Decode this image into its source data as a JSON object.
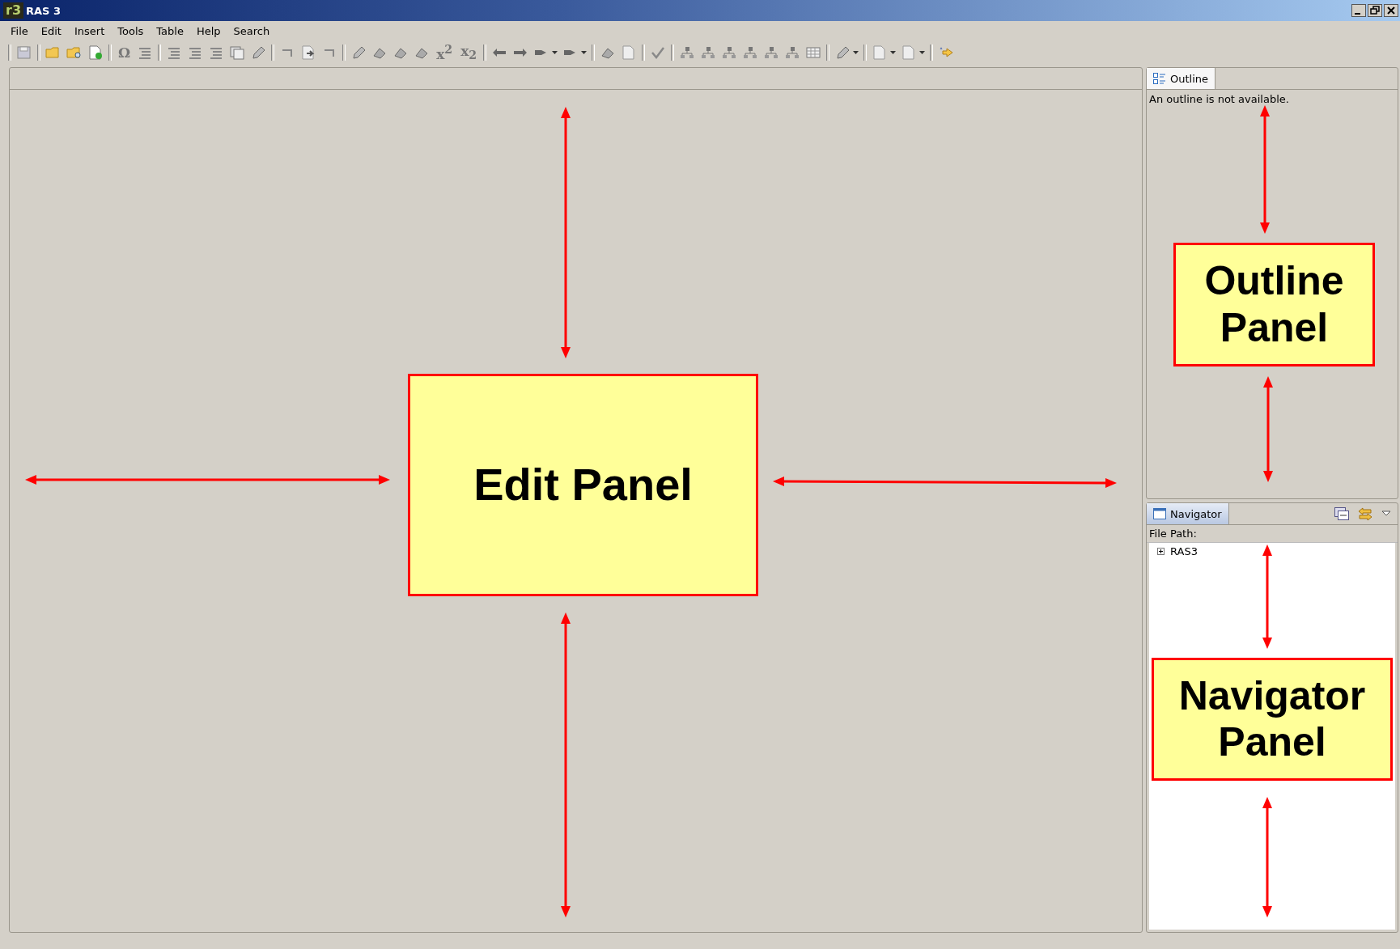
{
  "window": {
    "logo": "r3",
    "title": "RAS 3"
  },
  "menu": [
    "File",
    "Edit",
    "Insert",
    "Tools",
    "Table",
    "Help",
    "Search"
  ],
  "toolbar": {
    "glyphs": [
      "Ω",
      "x$^{2}$",
      "x$_{2}$"
    ]
  },
  "outline": {
    "tab": {
      "label": "Outline",
      "selected": true
    },
    "message": "An outline is not available."
  },
  "navigator": {
    "tab": {
      "label": "Navigator",
      "selected": true
    },
    "file_path_label": "File Path:",
    "tree": [
      {
        "label": "RAS3",
        "expanded": false
      }
    ]
  },
  "annotations": [
    {
      "label": "Edit Panel"
    },
    {
      "label": "Outline Panel"
    },
    {
      "label": "Navigator Panel"
    }
  ]
}
